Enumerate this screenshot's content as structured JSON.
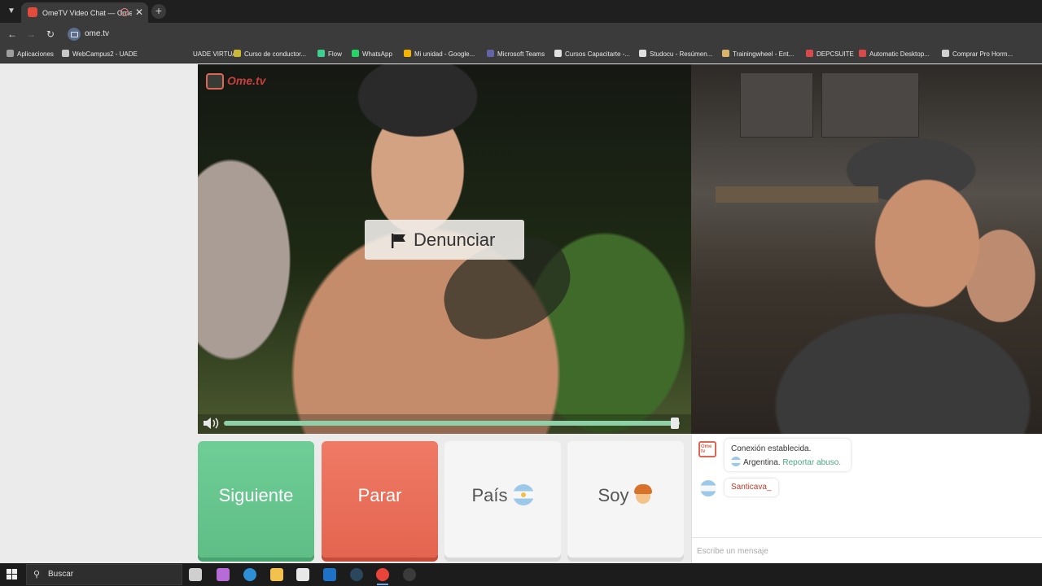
{
  "browser": {
    "tab_title": "OmeTV Video Chat — Ome",
    "url": "ome.tv",
    "bookmarks": [
      {
        "label": "Aplicaciones",
        "color": "#9e9e9e"
      },
      {
        "label": "WebCampus2 - UADE",
        "color": "#c7c7c7"
      },
      {
        "label": "UADE VIRTUAL",
        "color": "#3b3b3b"
      },
      {
        "label": "Curso de conductor...",
        "color": "#c9b736"
      },
      {
        "label": "Flow",
        "color": "#3ecf8e"
      },
      {
        "label": "WhatsApp",
        "color": "#25d366"
      },
      {
        "label": "Mi unidad - Google...",
        "color": "#f4b400"
      },
      {
        "label": "Microsoft Teams",
        "color": "#6264a7"
      },
      {
        "label": "Cursos Capacitarte -...",
        "color": "#e0e0e0"
      },
      {
        "label": "Studocu - Resúmen...",
        "color": "#e0e0e0"
      },
      {
        "label": "Trainingwheel - Ent...",
        "color": "#d9b36a"
      },
      {
        "label": "DEPCSUITE",
        "color": "#d84a4a"
      },
      {
        "label": "Automatic Desktop...",
        "color": "#d84a4a"
      },
      {
        "label": "Comprar Pro Horm...",
        "color": "#cfcfcf"
      }
    ]
  },
  "video": {
    "logo_text": "Ome.tv",
    "report_label": "Denunciar",
    "volume_level": 0.99
  },
  "actions": {
    "next_label": "Siguiente",
    "stop_label": "Parar",
    "country_label": "País",
    "gender_label": "Soy"
  },
  "chat": {
    "logo_text": "Ome tv",
    "system_line1": "Conexión establecida.",
    "system_country": "Argentina.",
    "report_link": "Reportar abuso.",
    "message_text": "Santicava_",
    "input_placeholder": "Escribe un mensaje"
  },
  "taskbar": {
    "search_label": "Buscar",
    "icons": [
      {
        "name": "task-view-icon",
        "color": "#cfcfcf"
      },
      {
        "name": "copilot-icon",
        "color": "#b66bd6"
      },
      {
        "name": "edge-icon",
        "color": "#2d8fd5"
      },
      {
        "name": "file-explorer-icon",
        "color": "#f2c14e"
      },
      {
        "name": "store-icon",
        "color": "#e8e8e8"
      },
      {
        "name": "outlook-icon",
        "color": "#1d72c7"
      },
      {
        "name": "steam-icon",
        "color": "#2a475e"
      },
      {
        "name": "chrome-icon",
        "color": "#e9443a"
      },
      {
        "name": "obs-icon",
        "color": "#3b3b3b"
      }
    ]
  }
}
